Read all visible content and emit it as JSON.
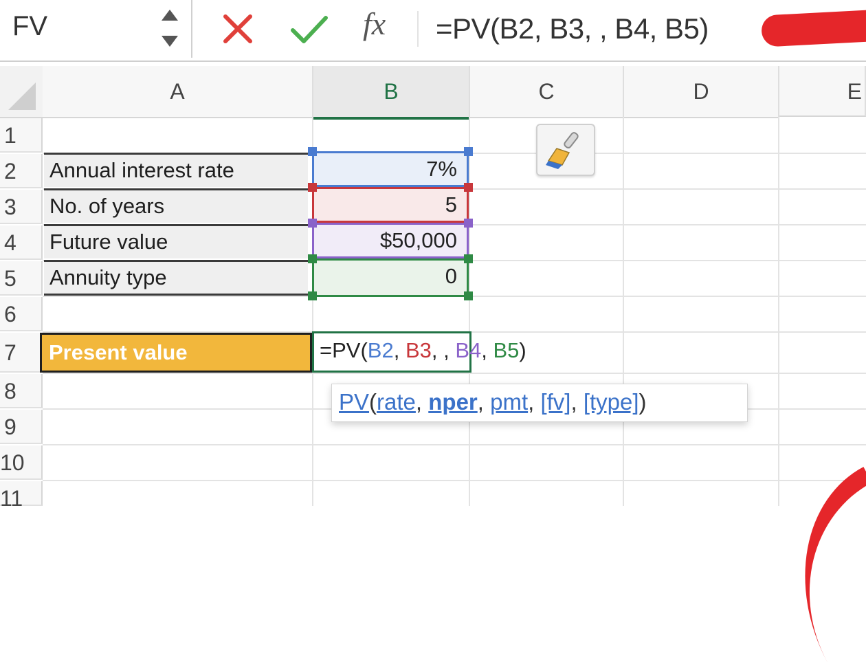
{
  "name_box": {
    "value": "FV"
  },
  "formula_bar": {
    "fx_label": "fx",
    "formula": "=PV(B2, B3, , B4, B5)"
  },
  "columns": [
    "A",
    "B",
    "C",
    "D",
    "E"
  ],
  "rows": [
    "1",
    "2",
    "3",
    "4",
    "5",
    "6",
    "7",
    "8",
    "9",
    "10",
    "11"
  ],
  "cells": {
    "A2": "Annual interest rate",
    "A3": "No. of years",
    "A4": "Future value",
    "A5": "Annuity type",
    "A7": "Present value",
    "B2": "7%",
    "B3": "5",
    "B4": "$50,000",
    "B5": "0"
  },
  "edit_cell": {
    "prefix": "=PV(",
    "ref1": "B2",
    "sep1": ", ",
    "ref2": "B3",
    "sep2": ", , ",
    "ref3": "B4",
    "sep3": ", ",
    "ref4": "B5",
    "suffix": ")"
  },
  "tooltip": {
    "fn": "PV",
    "open": "(",
    "arg1": "rate",
    "c1": ", ",
    "arg2": "nper",
    "c2": ", ",
    "arg3": "pmt",
    "c3": ", ",
    "arg4": "[fv]",
    "c4": ", ",
    "arg5": "[type]",
    "close": ")"
  },
  "colors": {
    "excel_green": "#217346",
    "ref_b2": "#4a7bd0",
    "ref_b3": "#c8373b",
    "ref_b4": "#8a62c9",
    "ref_b5": "#2f8a45",
    "present_value_fill": "#f2b73c",
    "annotation_red": "#e5262a"
  },
  "icons": [
    "spinner-arrows-icon",
    "cancel-x-icon",
    "confirm-check-icon",
    "fx-icon",
    "paintbrush-icon"
  ]
}
